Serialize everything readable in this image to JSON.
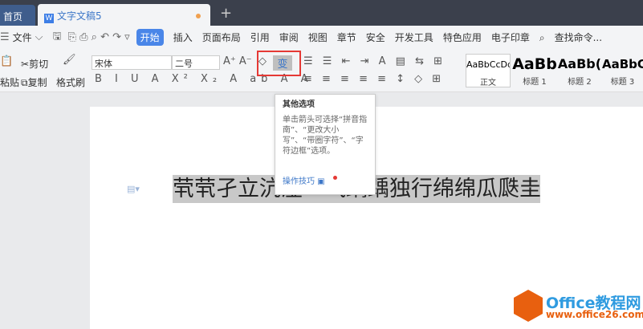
{
  "tabs": {
    "home": "首页",
    "doc": "文字文稿5",
    "new": "+"
  },
  "menu": {
    "file": "文件",
    "items": [
      "开始",
      "插入",
      "页面布局",
      "引用",
      "审阅",
      "视图",
      "章节",
      "安全",
      "开发工具",
      "特色应用",
      "电子印章"
    ],
    "search": "查找命令..."
  },
  "ribbon": {
    "cut": "剪切",
    "paste": "粘贴",
    "copy": "复制",
    "format_painter": "格式刷",
    "font": "宋体",
    "size": "二号",
    "pinyin_icon": "变",
    "styles": [
      {
        "sample": "AaBbCcDd",
        "label": "正文"
      },
      {
        "sample": "AaBb",
        "label": "标题 1"
      },
      {
        "sample": "AaBb(",
        "label": "标题 2"
      },
      {
        "sample": "AaBbC",
        "label": "标题 3"
      }
    ]
  },
  "document": {
    "text": "茕茕孑立沆瀣一气踽踽独行绵绵瓜瓞圭臬"
  },
  "tooltip": {
    "title": "其他选项",
    "body": "单击箭头可选择“拼音指南”、“更改大小写”、“带圈字符”、“字符边框”选项。",
    "link": "操作技巧"
  },
  "watermark": {
    "line1": "Office教程网",
    "line2": "www.office26.com"
  },
  "colors": {
    "accent": "#4a86e8",
    "highlight_box": "#e53935"
  }
}
